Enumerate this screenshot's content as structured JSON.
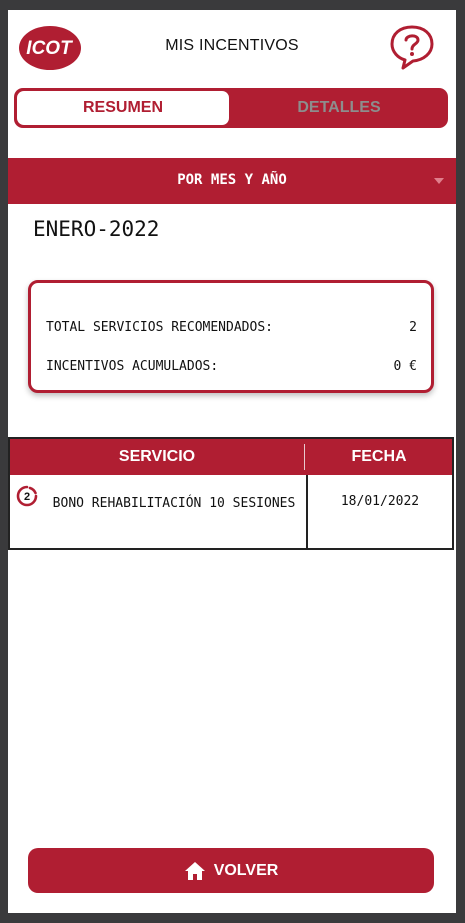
{
  "header": {
    "logo_text": "ICOT",
    "title": "MIS INCENTIVOS",
    "help_icon": "speech-bubble-question-icon"
  },
  "tabs": [
    {
      "label": "RESUMEN",
      "active": true
    },
    {
      "label": "DETALLES",
      "active": false
    }
  ],
  "period_selector": {
    "label": "POR MES Y AÑO",
    "icon": "caret-down-icon"
  },
  "month_title": "ENERO-2022",
  "summary": {
    "total_label": "TOTAL SERVICIOS RECOMENDADOS:",
    "total_value": "2",
    "incentives_label": "INCENTIVOS ACUMULADOS:",
    "incentives_value": "0 €"
  },
  "table": {
    "columns": [
      "SERVICIO",
      "FECHA"
    ],
    "rows": [
      {
        "badge": "2",
        "service": "BONO REHABILITACIÓN 10 SESIONES",
        "date": "18/01/2022"
      }
    ]
  },
  "back_button": {
    "label": "VOLVER",
    "icon": "home-icon"
  },
  "colors": {
    "brand": "#b01e32",
    "inactive_tab_text": "#8d8d8d",
    "frame": "#3a3a3c"
  }
}
